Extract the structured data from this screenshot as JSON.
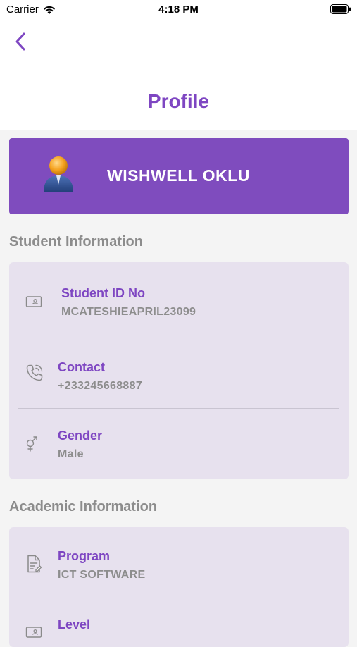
{
  "status_bar": {
    "carrier": "Carrier",
    "time": "4:18 PM"
  },
  "header": {
    "title": "Profile"
  },
  "profile": {
    "name": "WISHWELL OKLU"
  },
  "student_info": {
    "heading": "Student Information",
    "items": [
      {
        "label": "Student ID No",
        "value": "MCATESHIEAPRIL23099",
        "icon": "id-card-icon"
      },
      {
        "label": "Contact",
        "value": "+233245668887",
        "icon": "phone-icon"
      },
      {
        "label": "Gender",
        "value": "Male",
        "icon": "gender-icon"
      }
    ]
  },
  "academic_info": {
    "heading": "Academic Information",
    "items": [
      {
        "label": "Program",
        "value": "ICT SOFTWARE",
        "icon": "document-icon"
      },
      {
        "label": "Level",
        "value": "",
        "icon": "id-card-icon"
      }
    ]
  },
  "colors": {
    "accent": "#7f4cbe",
    "card": "#e7e1ee",
    "heading": "#8c8c8c"
  }
}
